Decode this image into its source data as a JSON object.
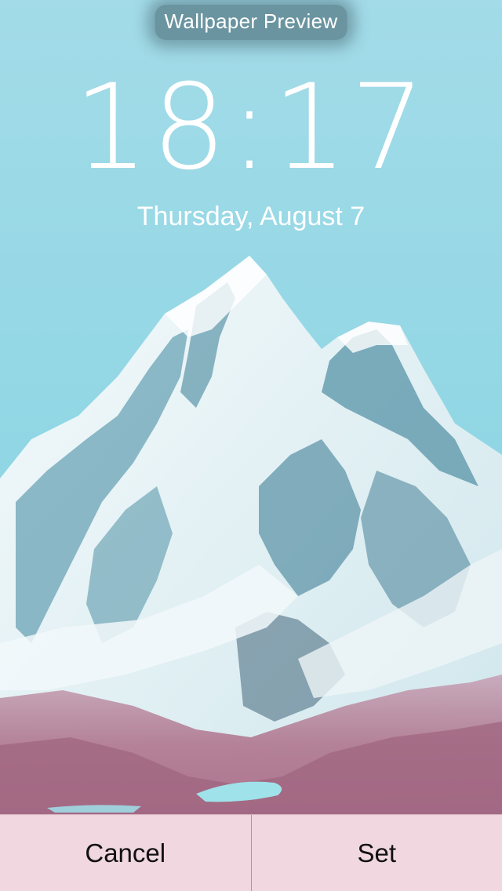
{
  "header": {
    "title": "Wallpaper Preview"
  },
  "lockscreen": {
    "time": "18:17",
    "date": "Thursday, August 7"
  },
  "wallpaper": {
    "subject": "snow-capped-mountain-icon",
    "sky_color": "#9bd9e6",
    "snow_color": "#eef6f8",
    "rock_color": "#4f8fa4",
    "foreground_color": "#a86a86",
    "lake_color": "#9fe2ea"
  },
  "actions": {
    "cancel_label": "Cancel",
    "set_label": "Set"
  }
}
